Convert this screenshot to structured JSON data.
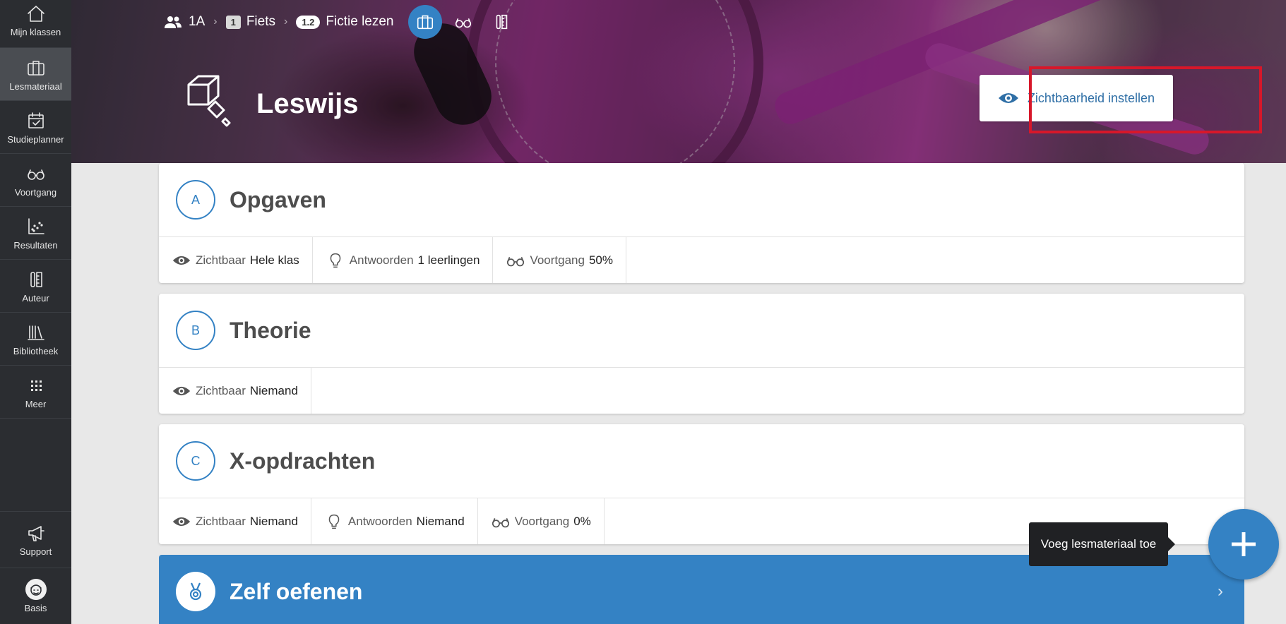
{
  "sidebar": {
    "items": [
      {
        "label": "Mijn klassen",
        "icon": "home-icon"
      },
      {
        "label": "Lesmateriaal",
        "icon": "briefcase-icon",
        "active": true
      },
      {
        "label": "Studieplanner",
        "icon": "calendar-check-icon"
      },
      {
        "label": "Voortgang",
        "icon": "glasses-icon"
      },
      {
        "label": "Resultaten",
        "icon": "scatter-chart-icon"
      },
      {
        "label": "Auteur",
        "icon": "author-icon"
      },
      {
        "label": "Bibliotheek",
        "icon": "library-icon"
      },
      {
        "label": "Meer",
        "icon": "grid-icon"
      }
    ],
    "bottom": [
      {
        "label": "Support",
        "icon": "megaphone-icon"
      },
      {
        "label": "Basis",
        "icon": "avatar-icon"
      }
    ]
  },
  "breadcrumb": {
    "class_label": "1A",
    "chapter_number": "1",
    "chapter_label": "Fiets",
    "section_number": "1.2",
    "section_label": "Fictie lezen"
  },
  "hero": {
    "title": "Leswijs",
    "visibility_button": "Zichtbaarheid instellen"
  },
  "cards": [
    {
      "letter": "A",
      "title": "Opgaven",
      "meta": [
        {
          "icon": "eye-icon",
          "label": "Zichtbaar",
          "value": "Hele klas"
        },
        {
          "icon": "lightbulb-icon",
          "label": "Antwoorden",
          "value": "1 leerlingen"
        },
        {
          "icon": "glasses-icon",
          "label": "Voortgang",
          "value": "50%"
        }
      ]
    },
    {
      "letter": "B",
      "title": "Theorie",
      "meta": [
        {
          "icon": "eye-icon",
          "label": "Zichtbaar",
          "value": "Niemand"
        }
      ]
    },
    {
      "letter": "C",
      "title": "X-opdrachten",
      "meta": [
        {
          "icon": "eye-icon",
          "label": "Zichtbaar",
          "value": "Niemand"
        },
        {
          "icon": "lightbulb-icon",
          "label": "Antwoorden",
          "value": "Niemand"
        },
        {
          "icon": "glasses-icon",
          "label": "Voortgang",
          "value": "0%"
        }
      ]
    }
  ],
  "practice": {
    "title": "Zelf oefenen"
  },
  "tooltip": "Voeg lesmateriaal toe",
  "colors": {
    "accent": "#3482c4",
    "sidebar": "#2b2d31",
    "highlight": "#d7172a"
  }
}
